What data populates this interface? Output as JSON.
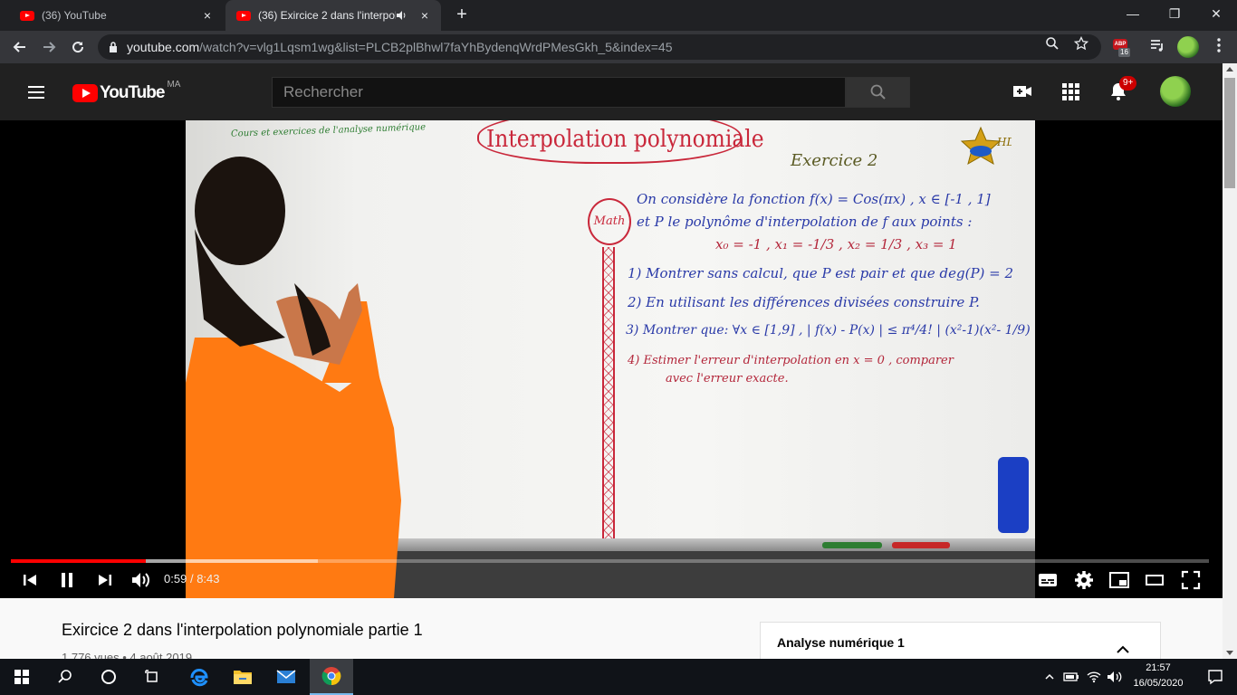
{
  "browser": {
    "tabs": [
      {
        "title": "(36) YouTube",
        "close": "×"
      },
      {
        "title": "(36) Exircice 2 dans l'interpol",
        "close": "×",
        "audio_icon": "speaker-icon"
      }
    ],
    "new_tab": "+",
    "window_controls": {
      "minimize": "—",
      "restore": "❐",
      "close": "✕"
    },
    "url_host": "youtube.com",
    "url_path": "/watch?v=vlg1Lqsm1wg&list=PLCB2plBhwl7faYhBydenqWrdPMesGkh_5&index=45",
    "extension_badge": {
      "label": "ABP",
      "count": "16"
    }
  },
  "youtube": {
    "logo_text": "YouTube",
    "country_code": "MA",
    "search_placeholder": "Rechercher",
    "notification_count": "9+"
  },
  "video_frame": {
    "course_label": "Cours et exercices de l'analyse numérique",
    "board_title": "Interpolation polynomiale",
    "exercise_label": "Exercice 2",
    "math_label": "Math",
    "logo_text": "HD",
    "lines": [
      "On considère la fonction  f(x) = Cos(πx) ,  x ∈ [-1 , 1]",
      "et P le polynôme d'interpolation de f aux points :",
      "x₀ = -1  ,  x₁ = -1/3  ,  x₂ = 1/3  ,  x₃ = 1",
      "1) Montrer sans calcul, que P est pair et que deg(P) = 2",
      "2) En utilisant les différences divisées construire P.",
      "3) Montrer que:  ∀x ∈ [1,9] ,  | f(x) - P(x) | ≤ π⁴/4! | (x²-1)(x²- 1/9) |",
      "4) Estimer l'erreur d'interpolation en x = 0 , comparer",
      "avec l'erreur exacte."
    ]
  },
  "player": {
    "current_time": "0:59",
    "separator": "/",
    "duration": "8:43",
    "progress": 0.113,
    "buffered": 0.256
  },
  "video_info": {
    "title": "Exircice 2 dans l'interpolation polynomiale partie 1",
    "meta": "1 776 vues • 4 août 2019"
  },
  "playlist": {
    "title": "Analyse numérique 1"
  },
  "taskbar": {
    "time": "21:57",
    "date": "16/05/2020"
  },
  "colors": {
    "youtube_red": "#ff0000",
    "board_red": "#c9283b",
    "board_blue": "#2a3aa8",
    "shirt_orange": "#ff7a12"
  }
}
